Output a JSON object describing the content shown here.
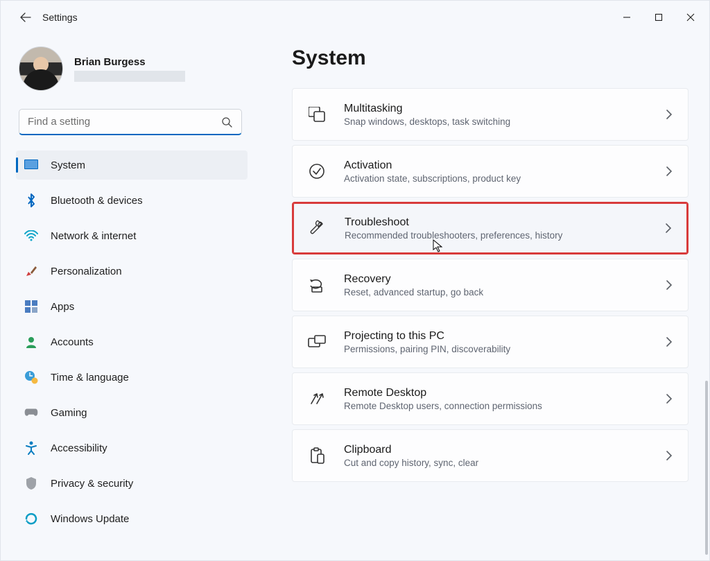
{
  "window": {
    "title": "Settings"
  },
  "profile": {
    "name": "Brian Burgess"
  },
  "search": {
    "placeholder": "Find a setting"
  },
  "nav": {
    "items": [
      {
        "label": "System"
      },
      {
        "label": "Bluetooth & devices"
      },
      {
        "label": "Network & internet"
      },
      {
        "label": "Personalization"
      },
      {
        "label": "Apps"
      },
      {
        "label": "Accounts"
      },
      {
        "label": "Time & language"
      },
      {
        "label": "Gaming"
      },
      {
        "label": "Accessibility"
      },
      {
        "label": "Privacy & security"
      },
      {
        "label": "Windows Update"
      }
    ]
  },
  "page": {
    "title": "System"
  },
  "cards": [
    {
      "title": "Multitasking",
      "desc": "Snap windows, desktops, task switching"
    },
    {
      "title": "Activation",
      "desc": "Activation state, subscriptions, product key"
    },
    {
      "title": "Troubleshoot",
      "desc": "Recommended troubleshooters, preferences, history"
    },
    {
      "title": "Recovery",
      "desc": "Reset, advanced startup, go back"
    },
    {
      "title": "Projecting to this PC",
      "desc": "Permissions, pairing PIN, discoverability"
    },
    {
      "title": "Remote Desktop",
      "desc": "Remote Desktop users, connection permissions"
    },
    {
      "title": "Clipboard",
      "desc": "Cut and copy history, sync, clear"
    }
  ]
}
